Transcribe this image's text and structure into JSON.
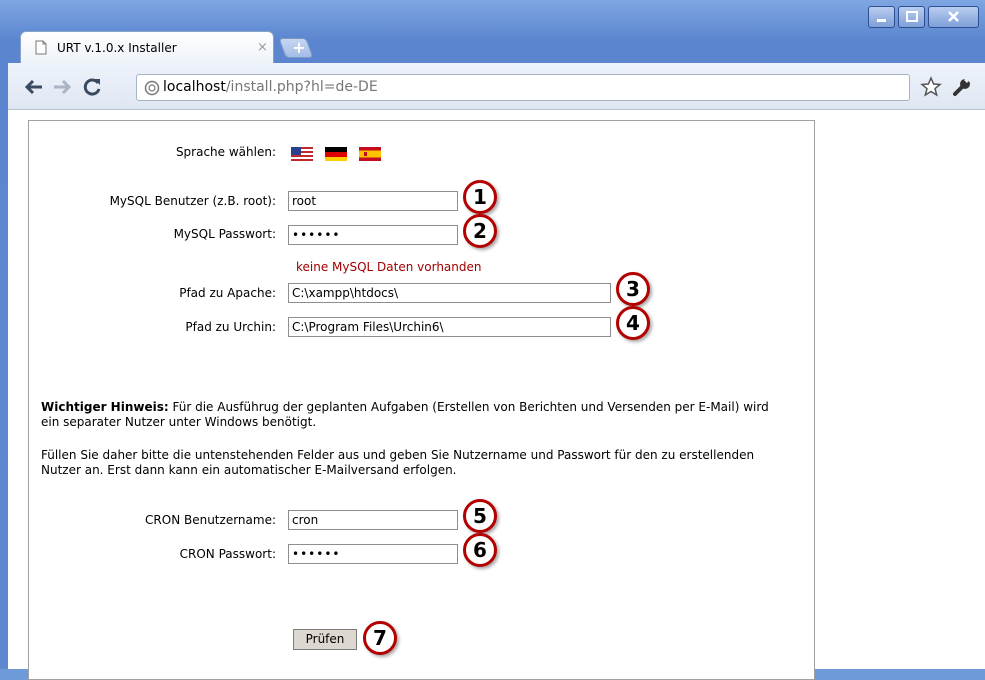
{
  "browser": {
    "tab_title": "URT v.1.0.x Installer",
    "tab_close": "×",
    "new_tab": "+",
    "url_host": "localhost",
    "url_path": "/install.php?hl=de-DE"
  },
  "form": {
    "language_label": "Sprache wählen:",
    "flags": [
      "us-flag",
      "de-flag",
      "es-flag"
    ],
    "mysql_user_label": "MySQL Benutzer (z.B. root):",
    "mysql_user_value": "root",
    "mysql_pass_label": "MySQL Passwort:",
    "mysql_pass_value": "••••••",
    "error": "keine MySQL Daten vorhanden",
    "apache_label": "Pfad zu Apache:",
    "apache_value": "C:\\xampp\\htdocs\\",
    "urchin_label": "Pfad zu Urchin:",
    "urchin_value": "C:\\Program Files\\Urchin6\\",
    "notice_bold": "Wichtiger Hinweis:",
    "notice_text": " Für die Ausführug der geplanten Aufgaben (Erstellen von Berichten und Versenden per E-Mail) wird ein separater Nutzer unter Windows benötigt.",
    "notice_text2": "Füllen Sie daher bitte die untenstehenden Felder aus und geben Sie Nutzername und Passwort für den zu erstellenden Nutzer an. Erst dann kann ein automatischer E-Mailversand erfolgen.",
    "cron_user_label": "CRON Benutzername:",
    "cron_user_value": "cron",
    "cron_pass_label": "CRON Passwort:",
    "cron_pass_value": "••••••",
    "submit_label": "Prüfen"
  },
  "markers": [
    "1",
    "2",
    "3",
    "4",
    "5",
    "6",
    "7"
  ],
  "colors": {
    "marker_ring": "#b30000",
    "error_text": "#a00000"
  }
}
